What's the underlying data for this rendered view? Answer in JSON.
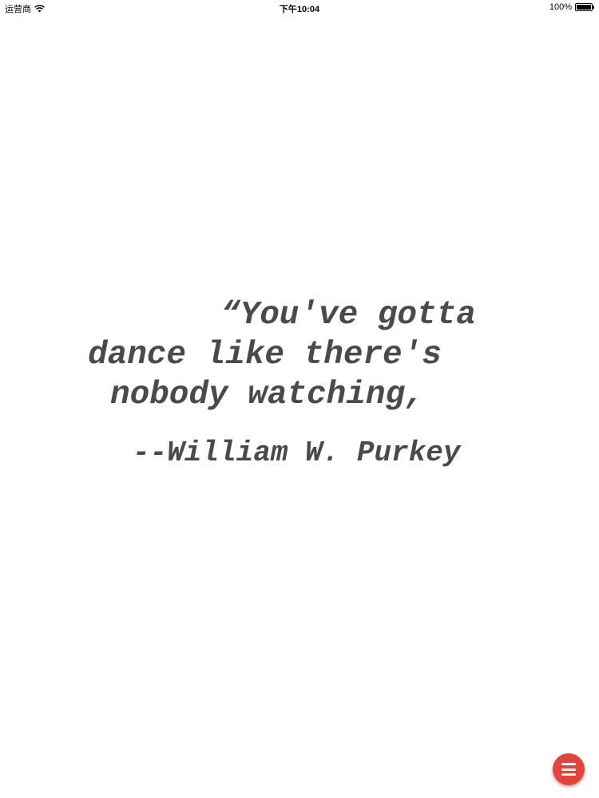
{
  "status_bar": {
    "carrier": "运营商",
    "time": "下午10:04",
    "battery_percent": "100%",
    "battery_level": 1.0
  },
  "quote": {
    "lines": [
      "“You've gotta",
      "dance like there's",
      "nobody watching,"
    ],
    "author": "--William W. Purkey",
    "text_color": "#4a4a4a"
  },
  "menu_button": {
    "icon": "hamburger-menu-icon",
    "color": "#e5443a"
  }
}
